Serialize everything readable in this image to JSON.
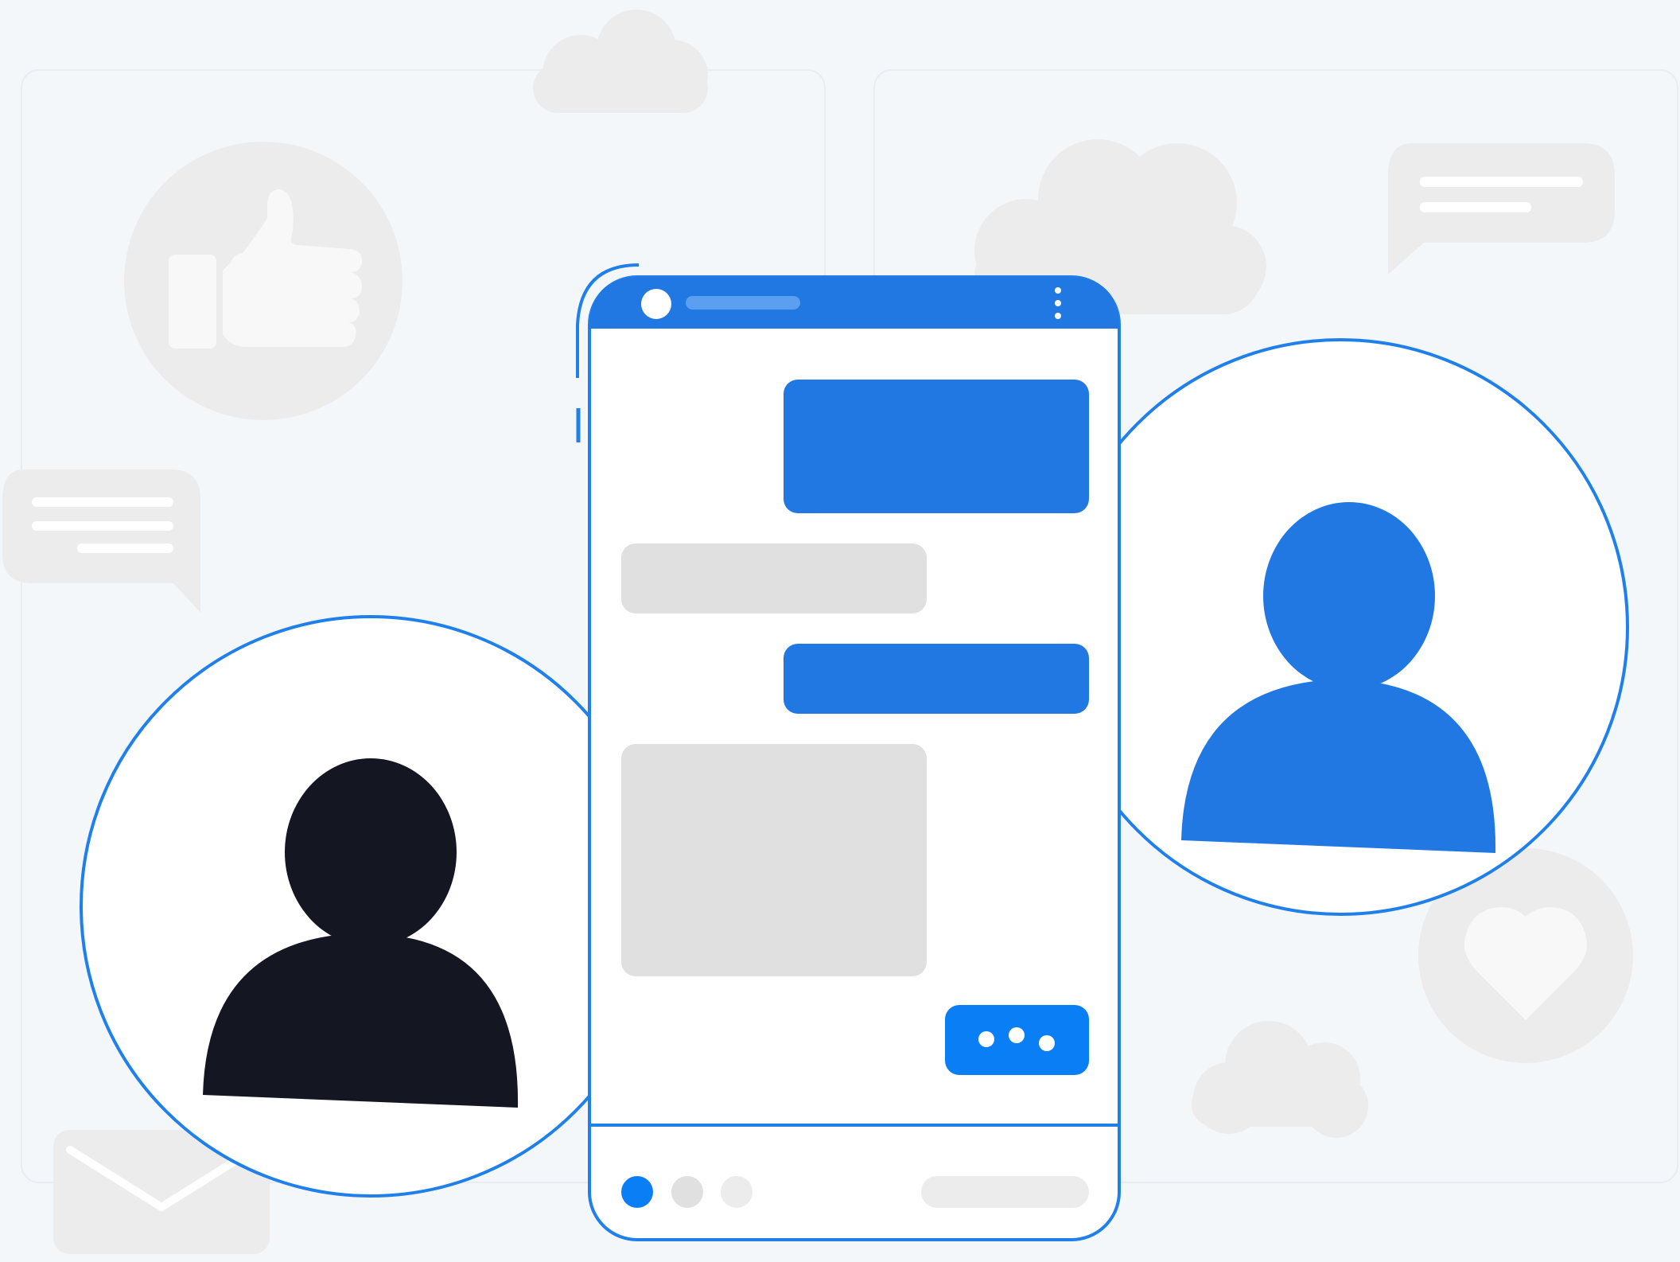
{
  "colors": {
    "background": "#f4f7fa",
    "panel_outline": "#e9edf1",
    "decor_gray": "#ececec",
    "decor_light": "#f8f8f8",
    "brand_blue": "#2178e2",
    "bright_blue": "#0a7ef5",
    "outline_blue": "#1f80ec",
    "bubble_gray": "#e0e0e0",
    "dark_figure": "#141621",
    "white": "#ffffff"
  },
  "decorations": {
    "icons": [
      "thumbs-up-icon",
      "heart-icon",
      "envelope-icon",
      "cloud-icon",
      "speech-bubble-icon"
    ]
  },
  "phone": {
    "header_icons": [
      "avatar-dot-icon",
      "more-vertical-icon"
    ],
    "messages": [
      {
        "side": "outgoing",
        "color": "blue"
      },
      {
        "side": "incoming",
        "color": "gray"
      },
      {
        "side": "outgoing",
        "color": "blue"
      },
      {
        "side": "incoming",
        "color": "gray"
      },
      {
        "side": "outgoing",
        "color": "blue",
        "content": "typing-indicator"
      }
    ],
    "footer": {
      "dots": [
        "active",
        "inactive",
        "inactive"
      ],
      "input": "input-pill"
    }
  },
  "avatars": [
    {
      "position": "left",
      "color": "dark"
    },
    {
      "position": "right",
      "color": "blue"
    }
  ]
}
